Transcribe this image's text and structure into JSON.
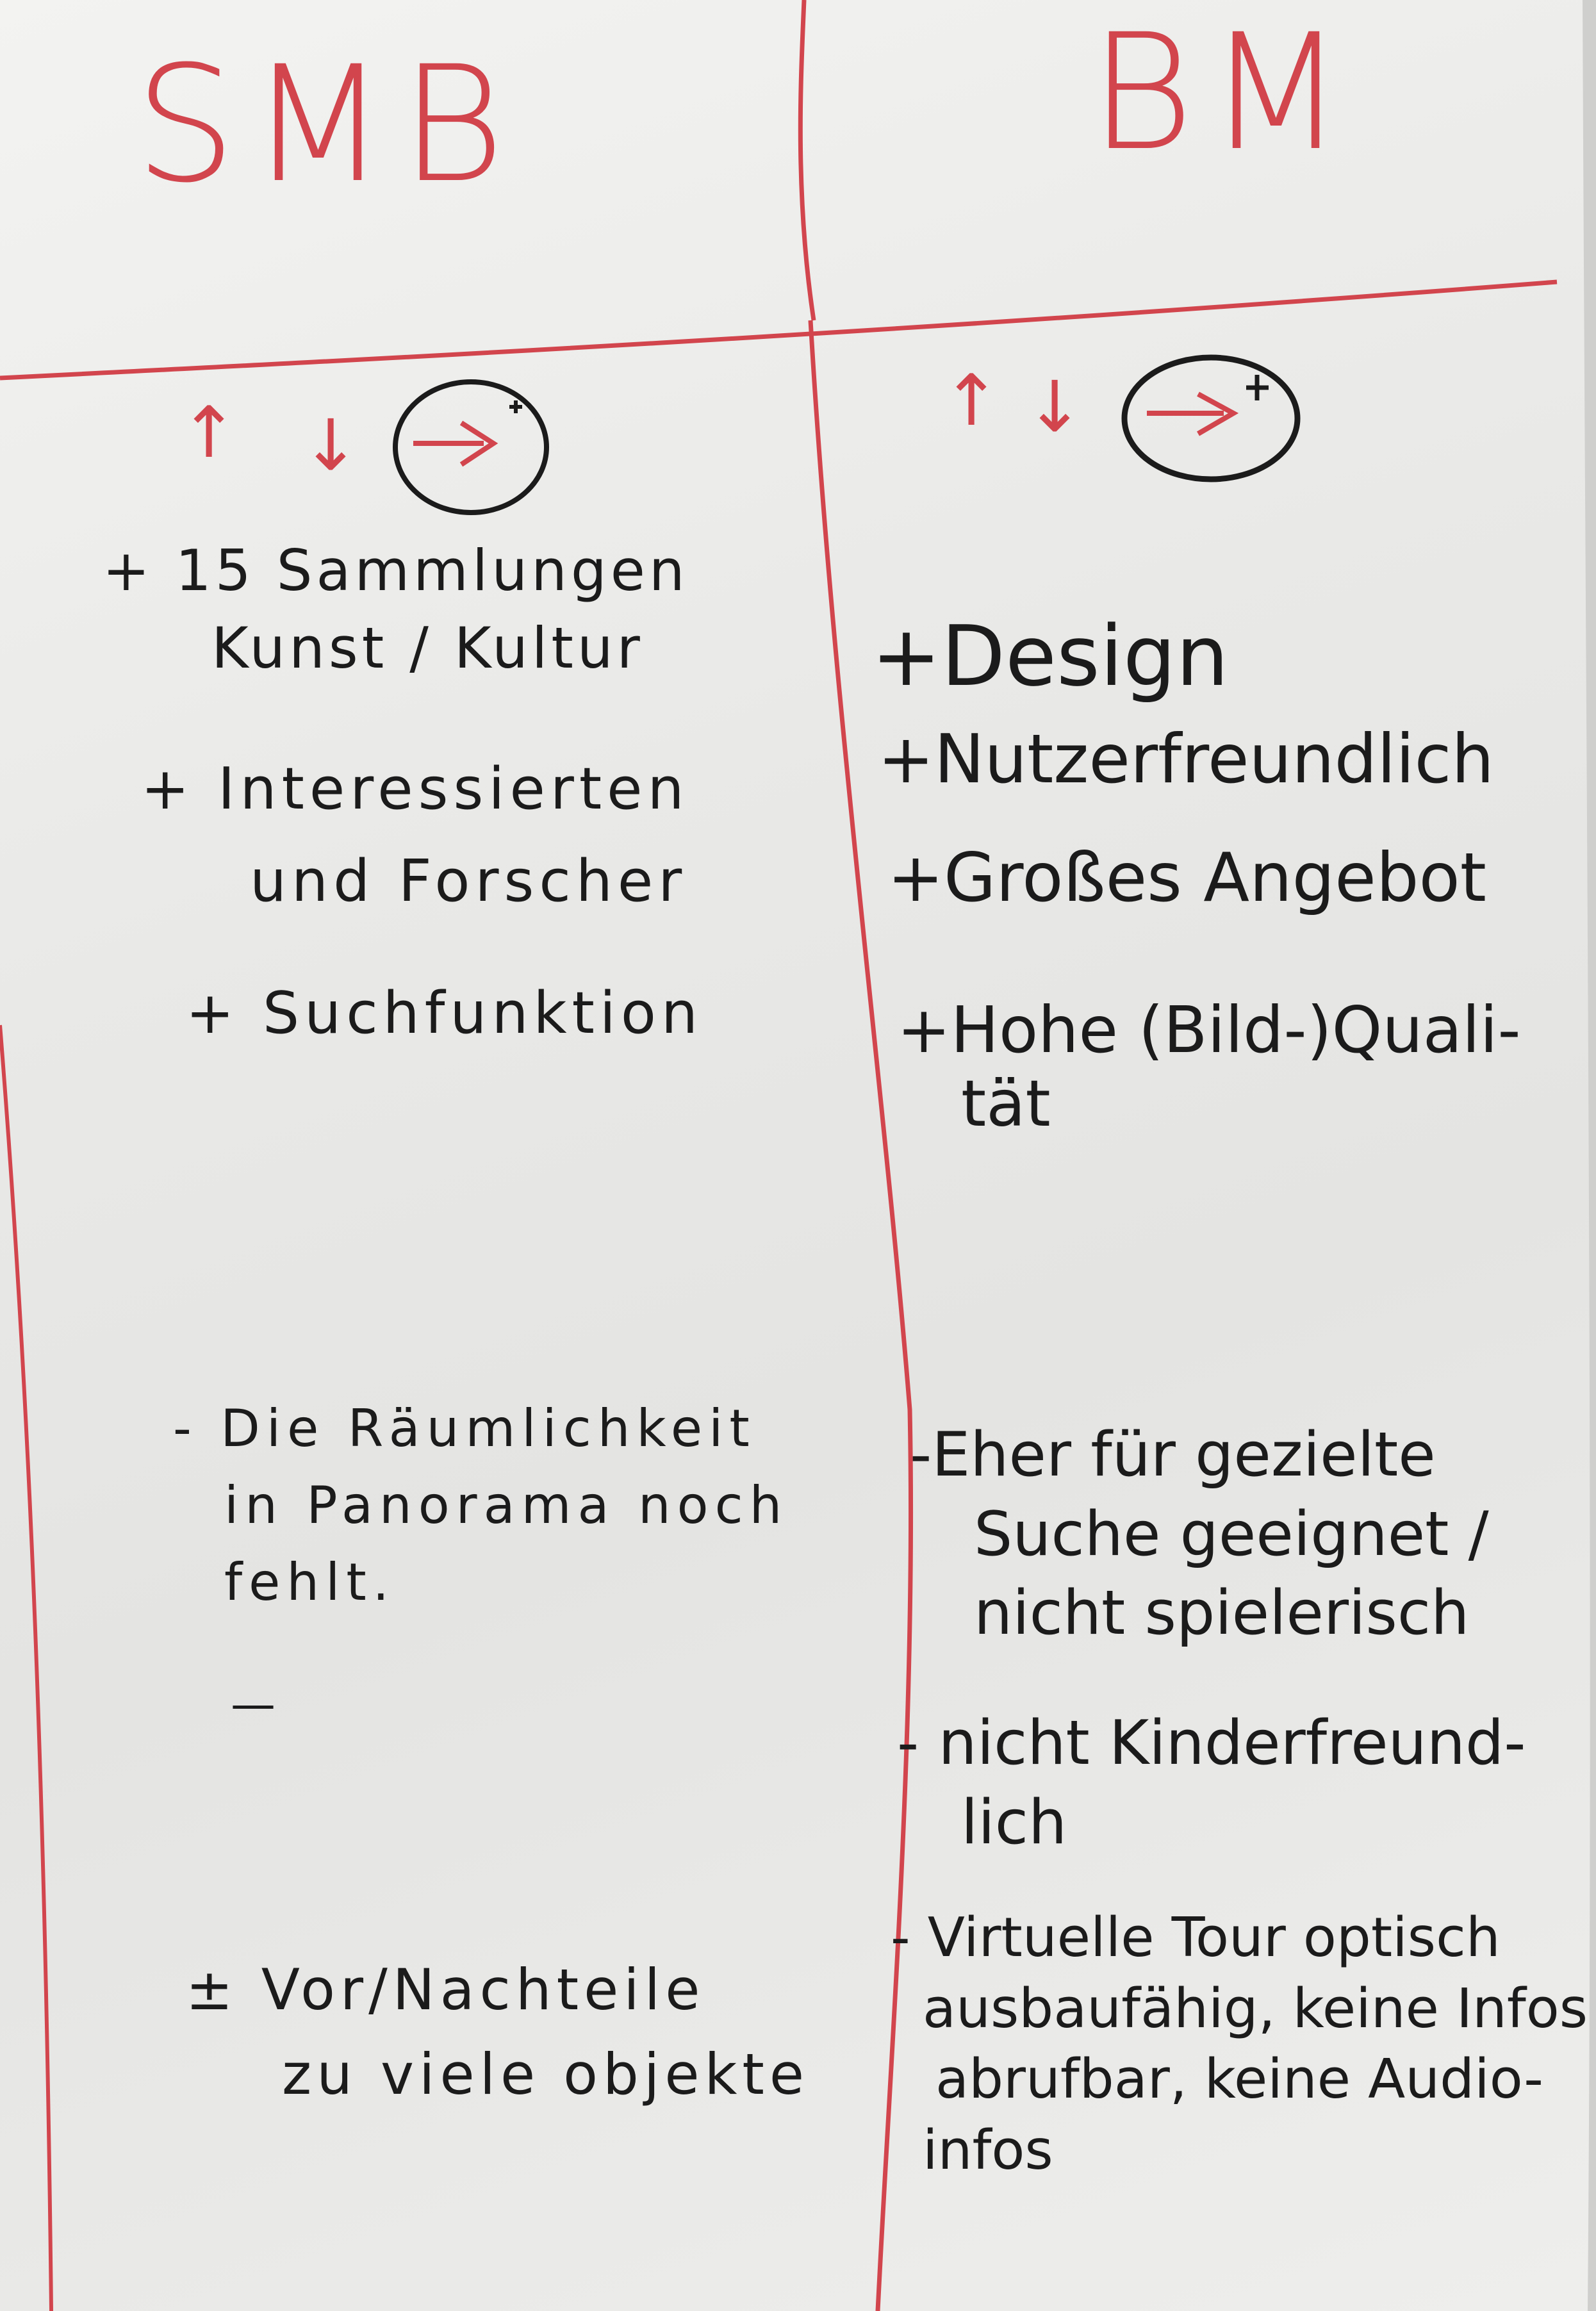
{
  "header": {
    "left_title": "SMB",
    "right_title": "BM"
  },
  "legend": {
    "up_arrow": "↑",
    "down_arrow": "↓",
    "circle_symbol": "→+"
  },
  "left_column": {
    "pros": [
      {
        "line1": "+ 15 Sammlungen",
        "line2": "Kunst / Kultur"
      },
      {
        "line1": "+ Interessierten",
        "line2": "und Forscher"
      },
      {
        "line1": "+ Suchfunktion"
      }
    ],
    "cons": [
      {
        "line1": "- Die Räumlichkeit",
        "line2": "in Panorama noch",
        "line3": "fehlt."
      }
    ],
    "dash": "—",
    "pm": [
      {
        "line1": "± Vor/Nachteile",
        "line2": "zu viele objekte"
      }
    ]
  },
  "right_column": {
    "pros": [
      {
        "line1": "+Design"
      },
      {
        "line1": "+Nutzerfreundlich"
      },
      {
        "line1": "+Großes Angebot"
      },
      {
        "line1": "+Hohe (Bild-)Quali-",
        "line2": "tät"
      }
    ],
    "cons": [
      {
        "line1": "-Eher für gezielte",
        "line2": "Suche geeignet /",
        "line3": "nicht spielerisch"
      },
      {
        "line1": "- nicht Kinderfreund-",
        "line2": "lich"
      },
      {
        "line1": "- Virtuelle Tour optisch",
        "line2": "ausbaufähig, keine Infos",
        "line3": "abrufbar, keine Audio-",
        "line4": "infos"
      }
    ]
  },
  "colors": {
    "marker_red": "#d2454d",
    "marker_black": "#1b1b1b",
    "board": "#ececea"
  }
}
